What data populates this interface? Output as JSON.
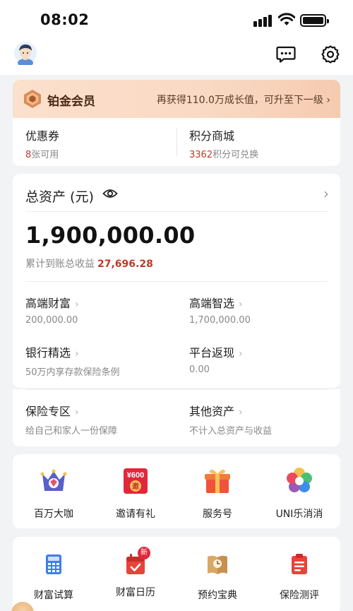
{
  "status_bar": {
    "time": "08:02"
  },
  "vip": {
    "level": "铂金会员",
    "upgrade_hint": "再获得110.0万成长值，可升至下一级",
    "coupon": {
      "title": "优惠券",
      "count": "8",
      "suffix": "张可用"
    },
    "points": {
      "title": "积分商城",
      "count": "3362",
      "suffix": "积分可兑换"
    }
  },
  "assets": {
    "title": "总资产 (元)",
    "total": "1,900,000.00",
    "earnings_label": "累计到账总收益",
    "earnings_value": "27,696.28",
    "items": [
      {
        "title": "高端财富",
        "value": "200,000.00"
      },
      {
        "title": "高端智选",
        "value": "1,700,000.00"
      },
      {
        "title": "银行精选",
        "value": "50万内享存款保险条例"
      },
      {
        "title": "平台返现",
        "value": "0.00"
      }
    ]
  },
  "insurance": [
    {
      "title": "保险专区",
      "desc": "给自己和家人一份保障"
    },
    {
      "title": "其他资产",
      "desc": "不计入总资产与收益"
    }
  ],
  "quick_icons": [
    {
      "label": "百万大咖",
      "icon": "crown-icon"
    },
    {
      "label": "邀请有礼",
      "icon": "invite-icon"
    },
    {
      "label": "服务号",
      "icon": "gift-icon"
    },
    {
      "label": "UNI乐消消",
      "icon": "flower-icon"
    }
  ],
  "tools": [
    {
      "label": "财富试算",
      "icon": "calculator-icon"
    },
    {
      "label": "财富日历",
      "icon": "calendar-icon",
      "badge": "新"
    },
    {
      "label": "预约宝典",
      "icon": "book-icon"
    },
    {
      "label": "保险测评",
      "icon": "clipboard-icon"
    }
  ],
  "invite_icon_text": {
    "top": "¥600",
    "bottom": "邀"
  },
  "colors": {
    "accent_red": "#c0392b",
    "vip_bg": "#f9d9c3",
    "vip_text": "#4a2a17"
  }
}
